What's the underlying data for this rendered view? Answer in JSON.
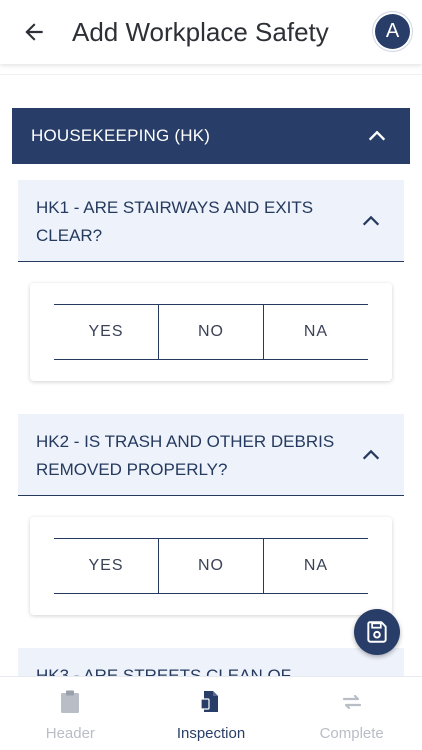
{
  "header": {
    "title": "Add Workplace Safety",
    "avatar_initial": "A"
  },
  "section": {
    "label": "HOUSEKEEPING (HK)"
  },
  "questions": [
    {
      "text": "HK1 - ARE STAIRWAYS AND EXITS CLEAR?",
      "options": [
        "YES",
        "NO",
        "NA"
      ]
    },
    {
      "text": "HK2 - IS TRASH AND OTHER DEBRIS REMOVED PROPERLY?",
      "options": [
        "YES",
        "NO",
        "NA"
      ]
    },
    {
      "text": "HK3 - ARE STREETS CLEAN OF"
    }
  ],
  "nav": {
    "items": [
      {
        "label": "Header",
        "icon": "clipboard-icon",
        "active": false
      },
      {
        "label": "Inspection",
        "icon": "document-icon",
        "active": true
      },
      {
        "label": "Complete",
        "icon": "swap-arrows-icon",
        "active": false
      }
    ]
  },
  "fab": {
    "icon": "save-icon"
  },
  "colors": {
    "primary": "#283e68",
    "question_bg": "#eef2fb",
    "inactive": "#b9bdc6"
  }
}
